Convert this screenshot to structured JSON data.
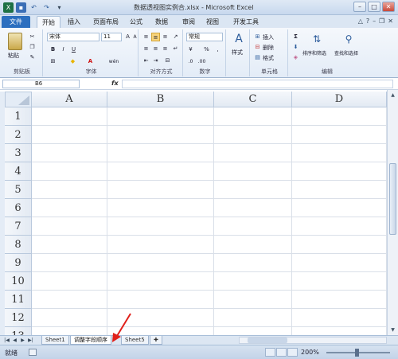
{
  "window": {
    "title": "数据透视图实例合.xlsx - Microsoft Excel"
  },
  "tabs": {
    "file": "文件",
    "items": [
      "开始",
      "插入",
      "页面布局",
      "公式",
      "数据",
      "审阅",
      "视图",
      "开发工具"
    ],
    "active": "开始"
  },
  "ribbon": {
    "clipboard": {
      "paste": "粘贴",
      "label": "剪贴板"
    },
    "font": {
      "name": "宋体",
      "size": "11",
      "bold": "B",
      "italic": "I",
      "underline": "U",
      "grow": "A",
      "shrink": "A",
      "color_char": "A",
      "wen": "wén",
      "label": "字体"
    },
    "alignment": {
      "label": "对齐方式"
    },
    "number": {
      "format": "常规",
      "percent": "%",
      "comma": ",",
      "label": "数字"
    },
    "styles": {
      "styles": "样式"
    },
    "cells": {
      "insert": "插入",
      "delete": "删除",
      "format": "格式",
      "label": "单元格"
    },
    "editing": {
      "sigma": "Σ",
      "sort": "排序和筛选",
      "find": "查找和选择",
      "label": "编辑"
    }
  },
  "formula_bar": {
    "name_box": "B6",
    "fx": "fx",
    "value": ""
  },
  "sheet": {
    "columns": [
      "A",
      "B",
      "C",
      "D"
    ],
    "rows": [
      "1",
      "2",
      "3",
      "4",
      "5",
      "6",
      "7",
      "8",
      "9",
      "10",
      "11",
      "12",
      "13"
    ]
  },
  "sheet_tabs": {
    "tabs": [
      "Sheet1",
      "调整字段顺序",
      "Sheet5"
    ],
    "active": "调整字段顺序"
  },
  "status": {
    "ready": "就绪",
    "zoom": "200%"
  },
  "colors": {
    "file_tab": "#2c6fbf",
    "annotation_arrow": "#e0201a"
  }
}
